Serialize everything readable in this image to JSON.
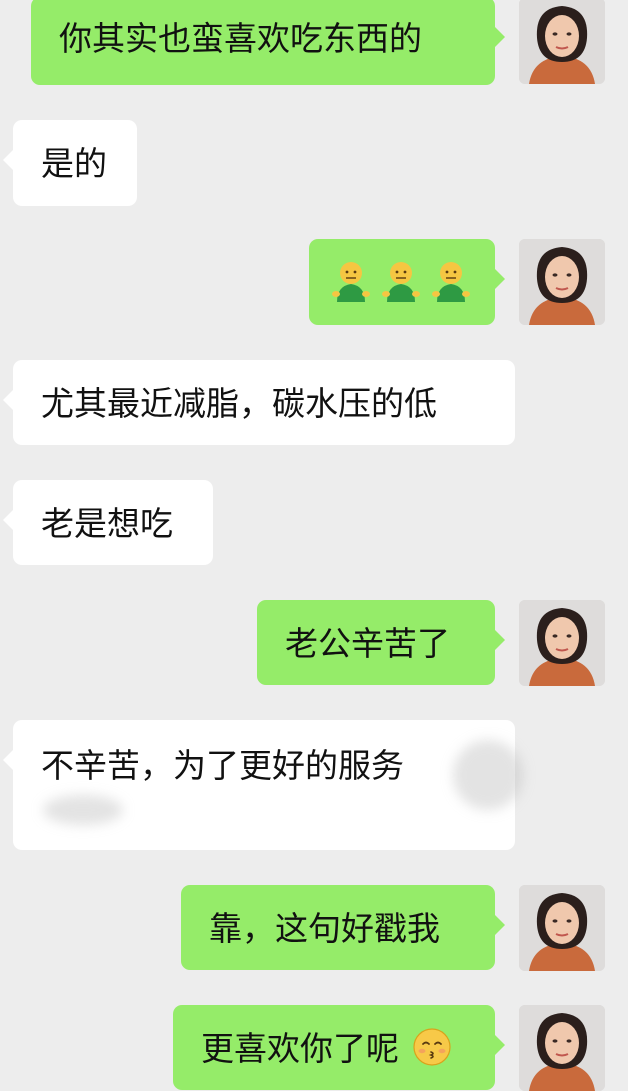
{
  "messages": [
    {
      "side": "right",
      "text": "你其实也蛮喜欢吃东西的"
    },
    {
      "side": "left",
      "text": "是的"
    },
    {
      "side": "right",
      "emoji_icons": [
        "green-figure-emoji",
        "green-figure-emoji",
        "green-figure-emoji"
      ]
    },
    {
      "side": "left",
      "text": "尤其最近减脂，碳水压的低"
    },
    {
      "side": "left",
      "text": "老是想吃"
    },
    {
      "side": "right",
      "text": "老公辛苦了"
    },
    {
      "side": "left",
      "text": "不辛苦，为了更好的服务"
    },
    {
      "side": "right",
      "text": "靠，这句好戳我"
    },
    {
      "side": "right",
      "text": "更喜欢你了呢",
      "trailing_icon": "kissing-face-emoji"
    }
  ],
  "colors": {
    "background": "#ededed",
    "incoming_bubble": "#ffffff",
    "outgoing_bubble": "#95ec69"
  }
}
